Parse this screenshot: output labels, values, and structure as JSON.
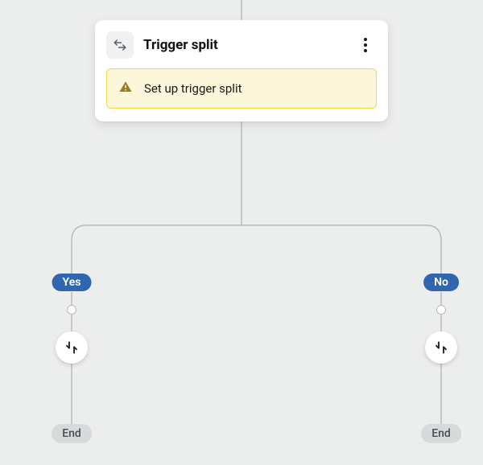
{
  "card": {
    "title": "Trigger split",
    "warning": "Set up trigger split"
  },
  "branches": {
    "yes": {
      "label": "Yes",
      "end": "End"
    },
    "no": {
      "label": "No",
      "end": "End"
    }
  },
  "layout": {
    "centerX": 300,
    "leftX": 89,
    "rightX": 548,
    "badgeY": 340,
    "dotY": 385,
    "nodeY": 432,
    "endY": 527
  },
  "colors": {
    "badge": "#3066b0",
    "line": "#b7b9bc",
    "warnBg": "#fdf7d9",
    "warnBorder": "#f2d74a"
  }
}
